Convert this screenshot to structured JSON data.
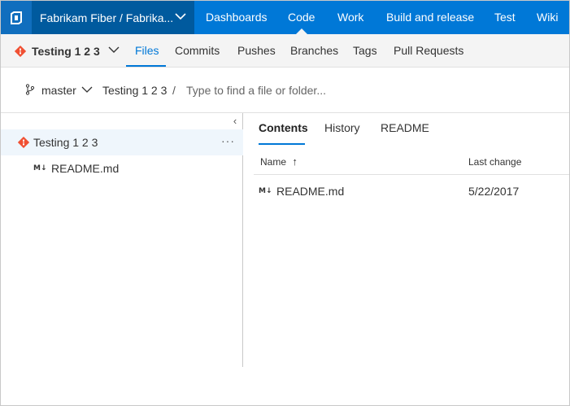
{
  "topbar": {
    "project": "Fabrikam Fiber / Fabrika...",
    "nav": [
      {
        "label": "Dashboards",
        "active": false
      },
      {
        "label": "Code",
        "active": true
      },
      {
        "label": "Work",
        "active": false
      },
      {
        "label": "Build and release",
        "active": false
      },
      {
        "label": "Test",
        "active": false
      },
      {
        "label": "Wiki",
        "active": false
      }
    ]
  },
  "subnav": {
    "repo": "Testing 1 2 3",
    "items": [
      {
        "label": "Files",
        "active": true
      },
      {
        "label": "Commits",
        "active": false
      },
      {
        "label": "Pushes",
        "active": false
      },
      {
        "label": "Branches",
        "active": false
      },
      {
        "label": "Tags",
        "active": false
      },
      {
        "label": "Pull Requests",
        "active": false
      }
    ]
  },
  "pathbar": {
    "branch": "master",
    "crumb": "Testing 1 2 3",
    "separator": "/",
    "placeholder": "Type to find a file or folder..."
  },
  "tree": {
    "collapse_glyph": "‹",
    "root": {
      "label": "Testing 1 2 3",
      "more": "···"
    },
    "children": [
      {
        "icon": "M↓",
        "label": "README.md"
      }
    ]
  },
  "content": {
    "tabs": [
      {
        "label": "Contents",
        "active": true
      },
      {
        "label": "History",
        "active": false
      },
      {
        "label": "README",
        "active": false
      }
    ],
    "columns": {
      "name": "Name",
      "sort_glyph": "↑",
      "last_change": "Last change"
    },
    "rows": [
      {
        "icon": "M↓",
        "name": "README.md",
        "date": "5/22/2017"
      }
    ]
  },
  "colors": {
    "brand_blue": "#0078d7",
    "project_bg": "#005a9e",
    "git_orange": "#f05033"
  },
  "icons": {
    "logo": "vsts-logo-icon",
    "repo": "git-repo-icon",
    "branch": "branch-icon",
    "file": "markdown-file-icon"
  }
}
